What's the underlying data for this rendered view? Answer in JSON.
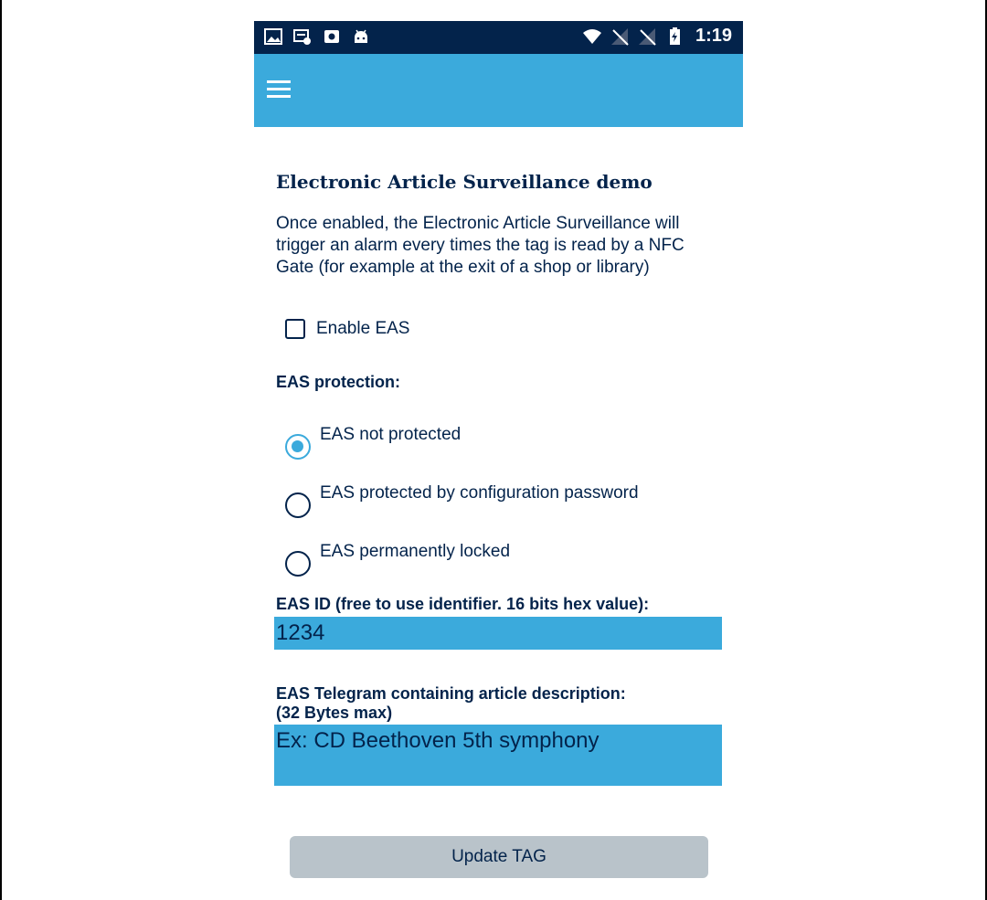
{
  "status_bar": {
    "left_icons": [
      "image-icon",
      "screen-share-icon",
      "photo-icon",
      "android-icon"
    ],
    "right_icons": [
      "wifi-icon",
      "signal-off-icon",
      "signal-off-icon",
      "battery-charging-icon"
    ],
    "time": "1:19"
  },
  "app_bar": {
    "menu_icon": "hamburger-menu-icon",
    "color": "#3baadc"
  },
  "content": {
    "title": "Electronic Article Surveillance demo",
    "description": "Once enabled, the Electronic Article Surveillance will trigger an alarm every times the tag is read by a NFC Gate (for example at the exit of a shop or library)",
    "enable_eas": {
      "label": "Enable EAS",
      "checked": false
    },
    "protection_label": "EAS protection:",
    "protection_options": [
      {
        "label": "EAS not protected",
        "selected": true
      },
      {
        "label": "EAS protected by configuration password",
        "selected": false
      },
      {
        "label": "EAS permanently locked",
        "selected": false
      }
    ],
    "eas_id_label": "EAS ID (free to use identifier. 16 bits hex value):",
    "eas_id_value": "1234",
    "telegram_label_line1": "EAS Telegram containing article description:",
    "telegram_label_line2": "(32 Bytes max)",
    "telegram_placeholder": "Ex: CD Beethoven 5th symphony",
    "update_button_label": "Update TAG"
  },
  "colors": {
    "primary": "#3baadc",
    "dark_blue": "#03234b",
    "button_gray": "#b9c3ca"
  }
}
